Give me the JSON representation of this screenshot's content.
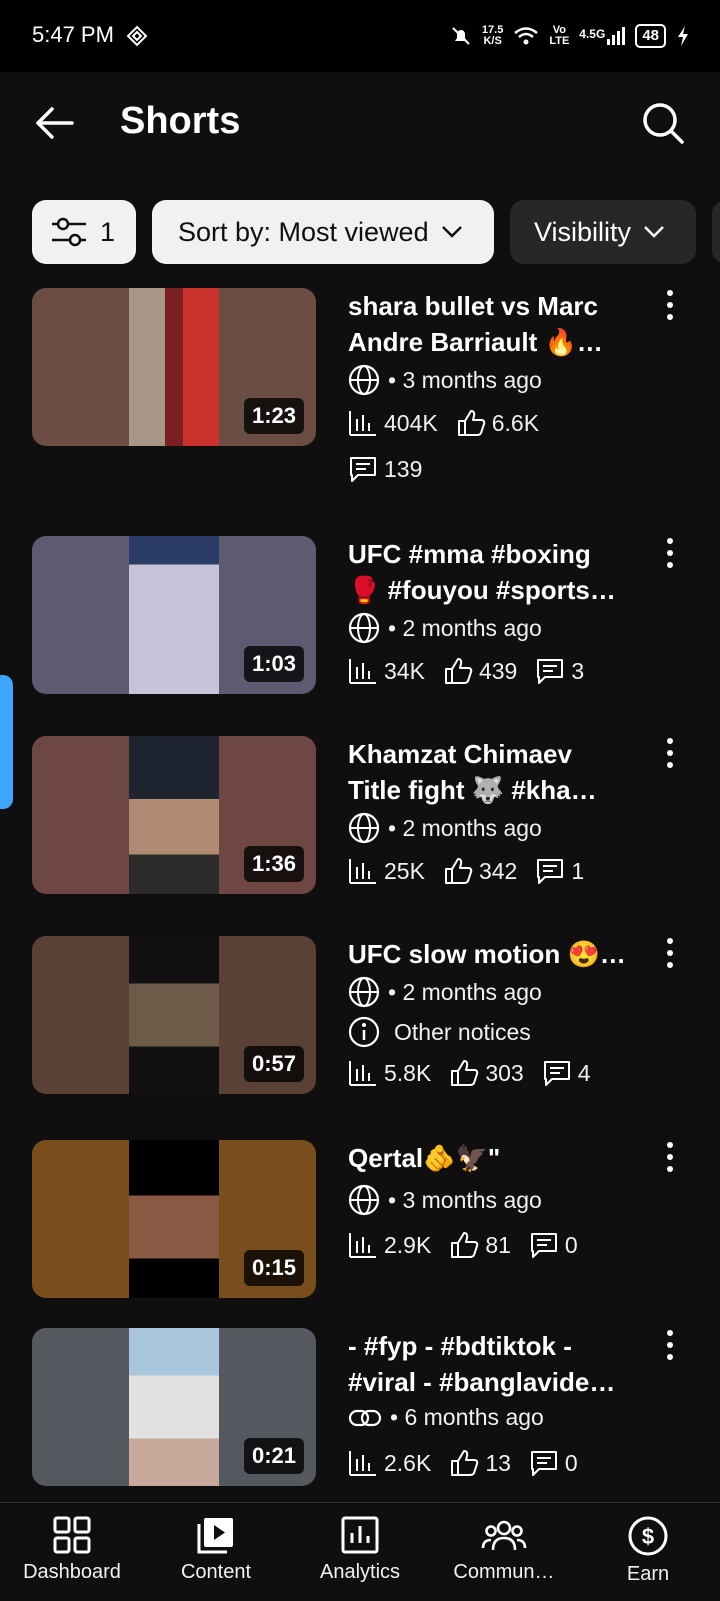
{
  "status_bar": {
    "time": "5:47 PM",
    "net_speed": "17.5",
    "net_unit": "K/S",
    "volte_top": "Vo",
    "volte_bottom": "LTE",
    "network": "4.5G",
    "battery": "48"
  },
  "header": {
    "title": "Shorts"
  },
  "chips": {
    "filter_count": "1",
    "sort_label": "Sort by: Most viewed",
    "visibility_label": "Visibility"
  },
  "videos": [
    {
      "title_line1": "shara bullet vs Marc",
      "title_line2": "Andre Barriault 🔥…",
      "visibility_icon": "globe-icon",
      "age": "• 3 months ago",
      "duration": "1:23",
      "views": "404K",
      "likes": "6.6K",
      "comments": "139",
      "thumb_bg": "#6b4d44"
    },
    {
      "title_line1": "UFC #mma #boxing",
      "title_line2": "🥊 #fouyou #sports…",
      "visibility_icon": "globe-icon",
      "age": "• 2 months ago",
      "duration": "1:03",
      "views": "34K",
      "likes": "439",
      "comments": "3",
      "thumb_bg": "#5d5a71"
    },
    {
      "title_line1": "Khamzat Chimaev",
      "title_line2": "Title fight 🐺 #kha…",
      "visibility_icon": "globe-icon",
      "age": "• 2 months ago",
      "duration": "1:36",
      "views": "25K",
      "likes": "342",
      "comments": "1",
      "thumb_bg": "#6e4744"
    },
    {
      "title_line1": "UFC slow motion 😍…",
      "visibility_icon": "globe-icon",
      "age": "• 2 months ago",
      "notice": "Other notices",
      "duration": "0:57",
      "views": "5.8K",
      "likes": "303",
      "comments": "4",
      "thumb_bg": "#5a4136"
    },
    {
      "title_line1": "Qertal🫵🦅\"",
      "visibility_icon": "globe-icon",
      "age": "• 3 months ago",
      "duration": "0:15",
      "views": "2.9K",
      "likes": "81",
      "comments": "0",
      "thumb_bg": "#7a4d1c"
    },
    {
      "title_line1": "- #fyp - #bdtiktok -",
      "title_line2": "#viral - #banglavide…",
      "visibility_icon": "link-icon",
      "age": "• 6 months ago",
      "duration": "0:21",
      "views": "2.6K",
      "likes": "13",
      "comments": "0",
      "thumb_bg": "#55585f"
    }
  ],
  "nav": [
    "Dashboard",
    "Content",
    "Analytics",
    "Commun…",
    "Earn"
  ]
}
